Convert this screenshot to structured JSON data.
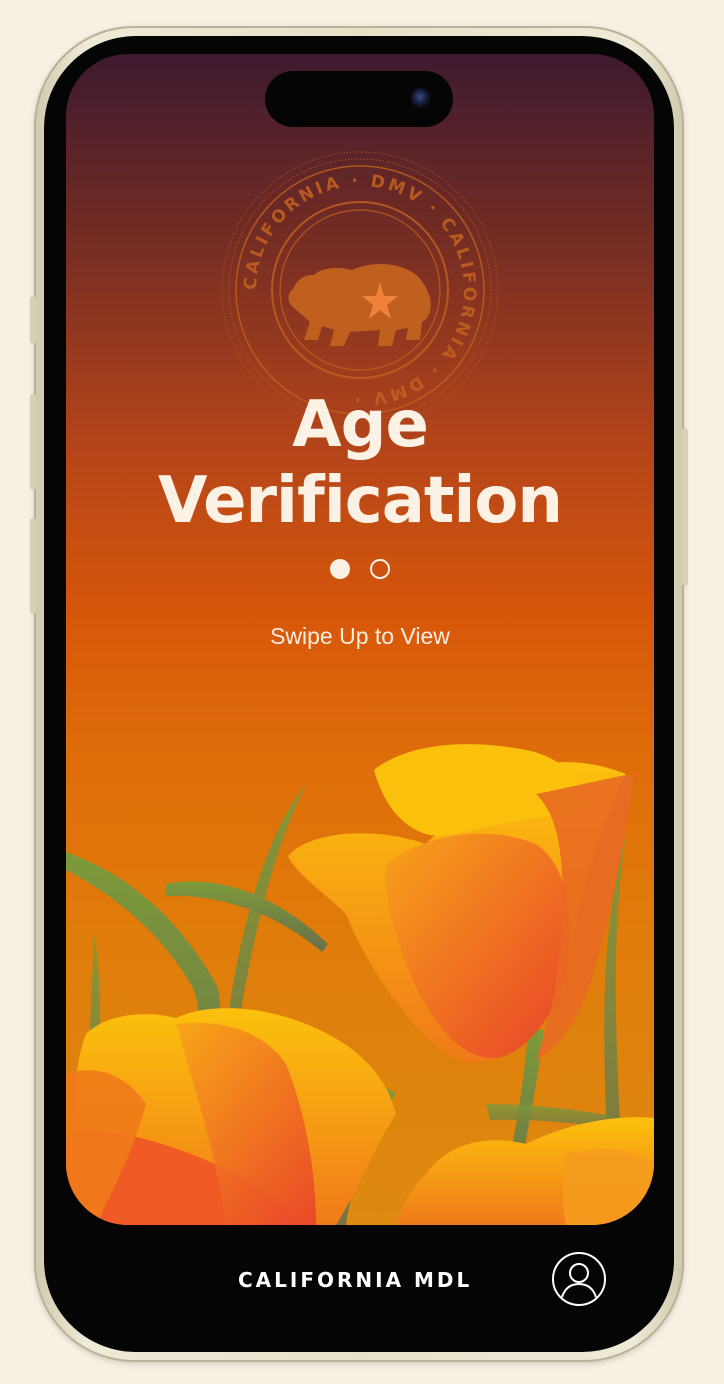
{
  "screen": {
    "title_line1": "Age",
    "title_line2": "Verification",
    "pager": {
      "pages": 2,
      "current": 1
    },
    "hint": "Swipe Up to View"
  },
  "seal": {
    "ring_text": "CALIFORNIA · DMV · CALIFORNIA · DMV · ",
    "icon": "california-bear-star-icon"
  },
  "footer": {
    "brand": "CALIFORNIA MDL",
    "profile_icon": "user-profile-icon"
  },
  "colors": {
    "background": "#f7f0e3",
    "gradient_top": "#3e1a30",
    "gradient_mid": "#d7570a",
    "gradient_bottom": "#dd8a10",
    "text_light": "#fbf1e4",
    "seal": "#c0601f",
    "poppy_yellow": "#fcbc0e",
    "poppy_red": "#e8402a",
    "stem_green": "#6f8b3a"
  }
}
